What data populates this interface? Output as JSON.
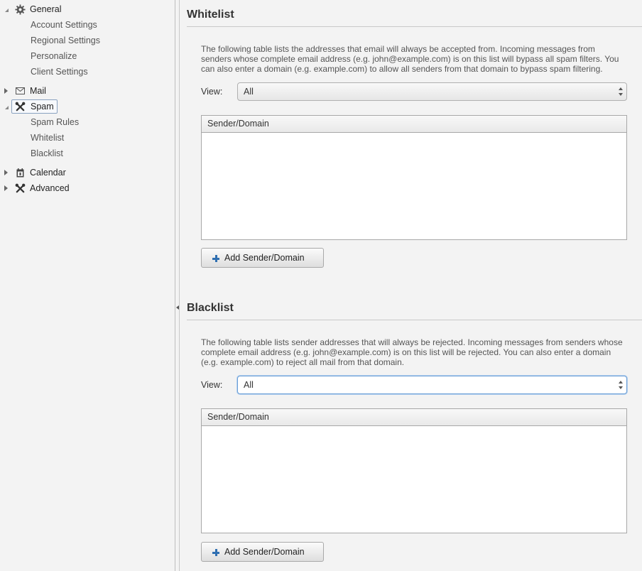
{
  "sidebar": {
    "general": {
      "label": "General",
      "icon": "gear-icon",
      "children": [
        "Account Settings",
        "Regional Settings",
        "Personalize",
        "Client Settings"
      ]
    },
    "mail": {
      "label": "Mail",
      "icon": "envelope-icon"
    },
    "spam": {
      "label": "Spam",
      "icon": "tools-icon",
      "children": [
        "Spam Rules",
        "Whitelist",
        "Blacklist"
      ]
    },
    "calendar": {
      "label": "Calendar",
      "icon": "calendar-icon"
    },
    "advanced": {
      "label": "Advanced",
      "icon": "tools-icon"
    }
  },
  "whitelist": {
    "title": "Whitelist",
    "description": "The following table lists the addresses that email will always be accepted from. Incoming messages from senders whose complete email address (e.g. john@example.com) is on this list will bypass all spam filters. You can also enter a domain (e.g. example.com) to allow all senders from that domain to bypass spam filtering.",
    "view_label": "View:",
    "view_value": "All",
    "column_header": "Sender/Domain",
    "add_button": "Add Sender/Domain"
  },
  "blacklist": {
    "title": "Blacklist",
    "description": "The following table lists sender addresses that will always be rejected. Incoming messages from senders whose complete email address (e.g. john@example.com) is on this list will be rejected. You can also enter a domain (e.g. example.com) to reject all mail from that domain.",
    "view_label": "View:",
    "view_value": "All",
    "column_header": "Sender/Domain",
    "add_button": "Add Sender/Domain"
  },
  "colors": {
    "accent": "#2f6fb1",
    "focus_border": "#6a9ed6",
    "background": "#f3f3f3"
  }
}
